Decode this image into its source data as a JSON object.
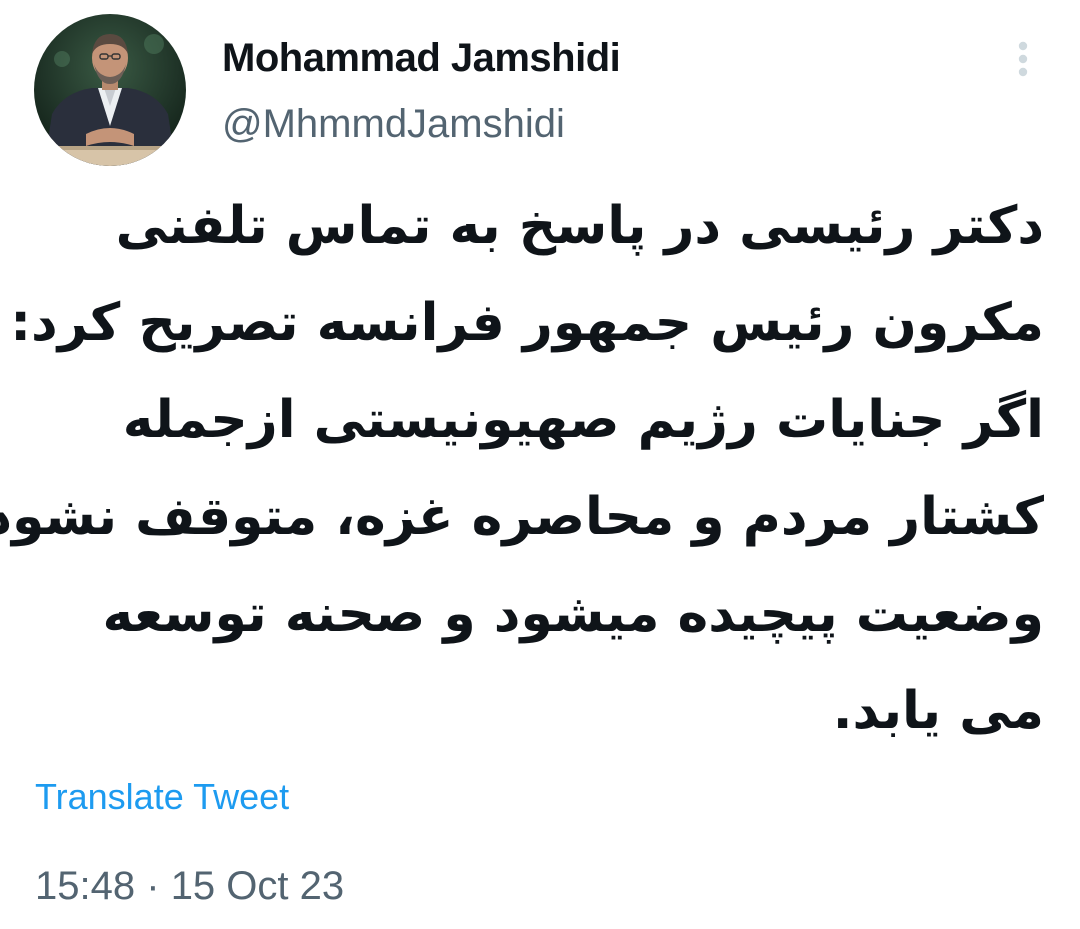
{
  "author": {
    "display_name": "Mohammad Jamshidi",
    "handle": "@MhmmdJamshidi",
    "avatar_icon": "profile-photo"
  },
  "tweet": {
    "lines": [
      "دکتر رئیسی در پاسخ به تماس تلفنی",
      "مکرون رئیس جمهور فرانسه تصریح کرد:",
      "اگر جنایات رژیم صهیونیستی ازجمله",
      "کشتار مردم و محاصره غزه، متوقف نشود",
      "وضعیت پیچیده میشود و صحنه توسعه",
      "می یابد."
    ],
    "translate_label": "Translate Tweet",
    "time": "15:48",
    "separator": "·",
    "date": "15 Oct 23"
  },
  "menu": {
    "icon": "more-vertical-icon"
  },
  "colors": {
    "text": "#0f1419",
    "secondary": "#536471",
    "link": "#1d9bf0",
    "more_icon": "#cfd9de"
  }
}
